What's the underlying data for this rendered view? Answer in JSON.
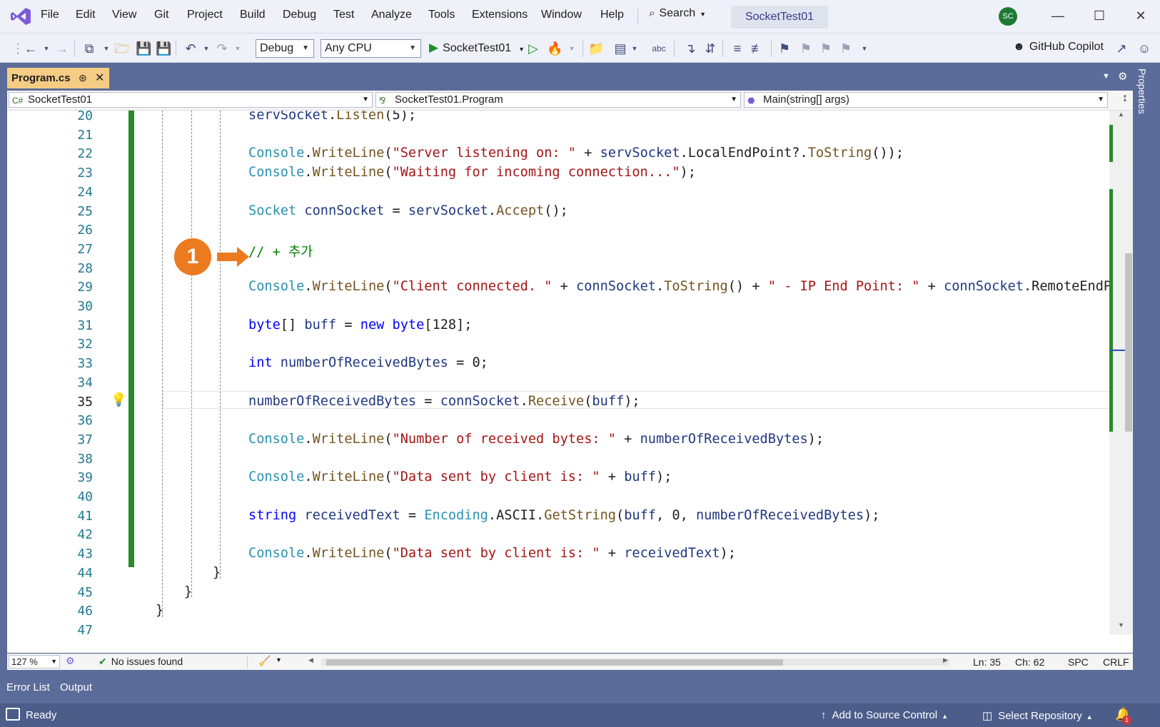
{
  "menu": [
    "File",
    "Edit",
    "View",
    "Git",
    "Project",
    "Build",
    "Debug",
    "Test",
    "Analyze",
    "Tools",
    "Extensions",
    "Window",
    "Help"
  ],
  "search_label": "Search",
  "solution_title": "SocketTest01",
  "avatar_initials": "SC",
  "toolbar": {
    "config": "Debug",
    "platform": "Any CPU",
    "run_target": "SocketTest01",
    "copilot": "GitHub Copilot"
  },
  "tab": {
    "name": "Program.cs"
  },
  "properties_label": "Properties",
  "nav": {
    "project": "SocketTest01",
    "class": "SocketTest01.Program",
    "member": "Main(string[] args)"
  },
  "editor": {
    "current_line": 35,
    "lines": [
      {
        "n": 20,
        "t": "servSocket.Listen(5);"
      },
      {
        "n": 21,
        "t": ""
      },
      {
        "n": 22,
        "t": "Console.WriteLine(\"Server listening on: \" + servSocket.LocalEndPoint?.ToString());"
      },
      {
        "n": 23,
        "t": "Console.WriteLine(\"Waiting for incoming connection...\");"
      },
      {
        "n": 24,
        "t": ""
      },
      {
        "n": 25,
        "t": "Socket connSocket = servSocket.Accept();"
      },
      {
        "n": 26,
        "t": ""
      },
      {
        "n": 27,
        "t": "// + 추가"
      },
      {
        "n": 28,
        "t": ""
      },
      {
        "n": 29,
        "t": "Console.WriteLine(\"Client connected. \" + connSocket.ToString() + \" - IP End Point: \" + connSocket.RemoteEndPoint?.T"
      },
      {
        "n": 30,
        "t": ""
      },
      {
        "n": 31,
        "t": "byte[] buff = new byte[128];"
      },
      {
        "n": 32,
        "t": ""
      },
      {
        "n": 33,
        "t": "int numberOfReceivedBytes = 0;"
      },
      {
        "n": 34,
        "t": ""
      },
      {
        "n": 35,
        "t": "numberOfReceivedBytes = connSocket.Receive(buff);"
      },
      {
        "n": 36,
        "t": ""
      },
      {
        "n": 37,
        "t": "Console.WriteLine(\"Number of received bytes: \" + numberOfReceivedBytes);"
      },
      {
        "n": 38,
        "t": ""
      },
      {
        "n": 39,
        "t": "Console.WriteLine(\"Data sent by client is: \" + buff);"
      },
      {
        "n": 40,
        "t": ""
      },
      {
        "n": 41,
        "t": "string receivedText = Encoding.ASCII.GetString(buff, 0, numberOfReceivedBytes);"
      },
      {
        "n": 42,
        "t": ""
      },
      {
        "n": 43,
        "t": "Console.WriteLine(\"Data sent by client is: \" + receivedText);"
      },
      {
        "n": 44,
        "t": "}"
      },
      {
        "n": 45,
        "t": "}"
      },
      {
        "n": 46,
        "t": "}"
      },
      {
        "n": 47,
        "t": ""
      }
    ]
  },
  "annotation_number": "1",
  "editor_status": {
    "zoom": "127 %",
    "issues": "No issues found",
    "ln": "Ln: 35",
    "ch": "Ch: 62",
    "spc": "SPC",
    "eol": "CRLF"
  },
  "tool_tabs": [
    "Error List",
    "Output"
  ],
  "status": {
    "ready": "Ready",
    "source_control": "Add to Source Control",
    "repo": "Select Repository",
    "notifications": "1"
  }
}
